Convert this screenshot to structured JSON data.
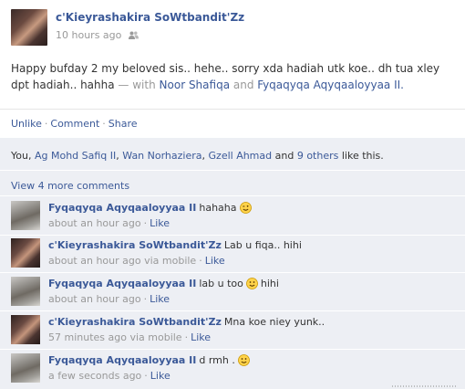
{
  "post": {
    "author": "c'Kieyrashakira SoWtbandit'Zz",
    "timestamp": "10 hours ago",
    "privacy_icon": "people-icon",
    "message_text": "Happy bufday 2 my beloved sis.. hehe.. sorry xda hadiah utk koe.. dh tua xley dpt hadiah.. hahha",
    "with_prefix": "— with",
    "tag_1": "Noor Shafiqa",
    "and_text": "and",
    "tag_2": "Fyqaqyqa Aqyqaaloyyaa II."
  },
  "actions": {
    "unlike": "Unlike",
    "comment": "Comment",
    "share": "Share",
    "separator": "·"
  },
  "likes": {
    "prefix": "You,",
    "person_1": "Ag Mohd Safiq II",
    "person_2": "Wan Norhaziera",
    "person_3": "Gzell Ahmad",
    "suffix_and": "and",
    "others": "9 others",
    "suffix": "like this."
  },
  "view_more": "View 4 more comments",
  "comments": [
    {
      "author": "Fyqaqyqa Aqyqaaloyyaa II",
      "text": "hahaha",
      "emoticon": "wink-smiley-icon",
      "text_after": "",
      "time": "about an hour ago",
      "like": "Like"
    },
    {
      "author": "c'Kieyrashakira SoWtbandit'Zz",
      "text": "Lab u fiqa.. hihi",
      "emoticon": "",
      "text_after": "",
      "time": "about an hour ago via mobile",
      "like": "Like"
    },
    {
      "author": "Fyqaqyqa Aqyqaaloyyaa II",
      "text": "lab u too",
      "emoticon": "smile-smiley-icon",
      "text_after": "hihi",
      "time": "about an hour ago",
      "like": "Like"
    },
    {
      "author": "c'Kieyrashakira SoWtbandit'Zz",
      "text": "Mna koe niey yunk..",
      "emoticon": "",
      "text_after": "",
      "time": "57 minutes ago via mobile",
      "like": "Like"
    },
    {
      "author": "Fyqaqyqa Aqyqaaloyyaa II",
      "text": "d rmh .",
      "emoticon": "smile-smiley-icon",
      "text_after": "",
      "time": "a few seconds ago",
      "like": "Like"
    }
  ],
  "meta_separator": "·",
  "colors": {
    "link": "#3b5998",
    "muted": "#999999",
    "feedback_bg": "#edeff4"
  }
}
